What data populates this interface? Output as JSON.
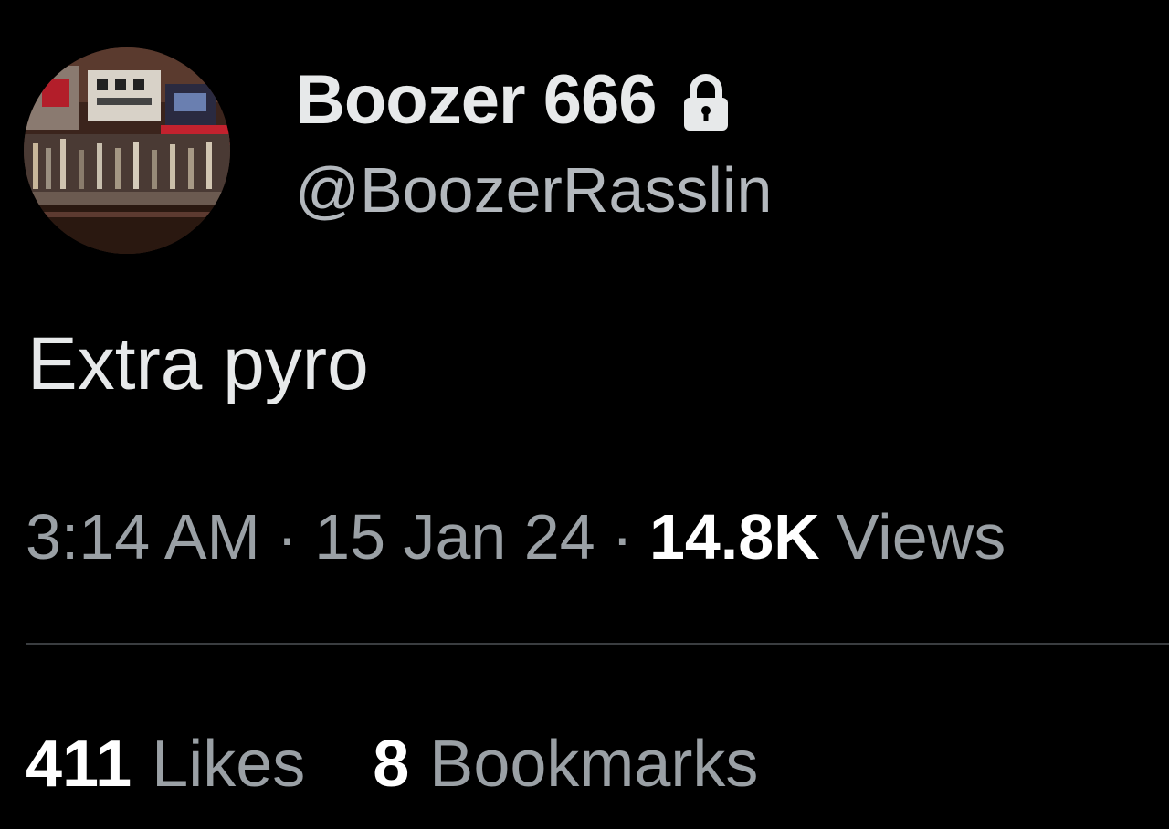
{
  "profile": {
    "display_name": "Boozer 666",
    "handle": "@BoozerRasslin",
    "protected_icon": "lock-icon",
    "avatar": "avatar-image"
  },
  "tweet": {
    "text": "Extra pyro",
    "time": "3:14 AM",
    "date": "15 Jan 24",
    "separator": "·",
    "views_count": "14.8K",
    "views_label": "Views"
  },
  "stats": {
    "likes_count": "411",
    "likes_label": "Likes",
    "bookmarks_count": "8",
    "bookmarks_label": "Bookmarks"
  },
  "colors": {
    "background": "#000000",
    "primary_text": "#e7e9ea",
    "secondary_text": "#9aa0a5",
    "divider": "#3a3d40"
  }
}
